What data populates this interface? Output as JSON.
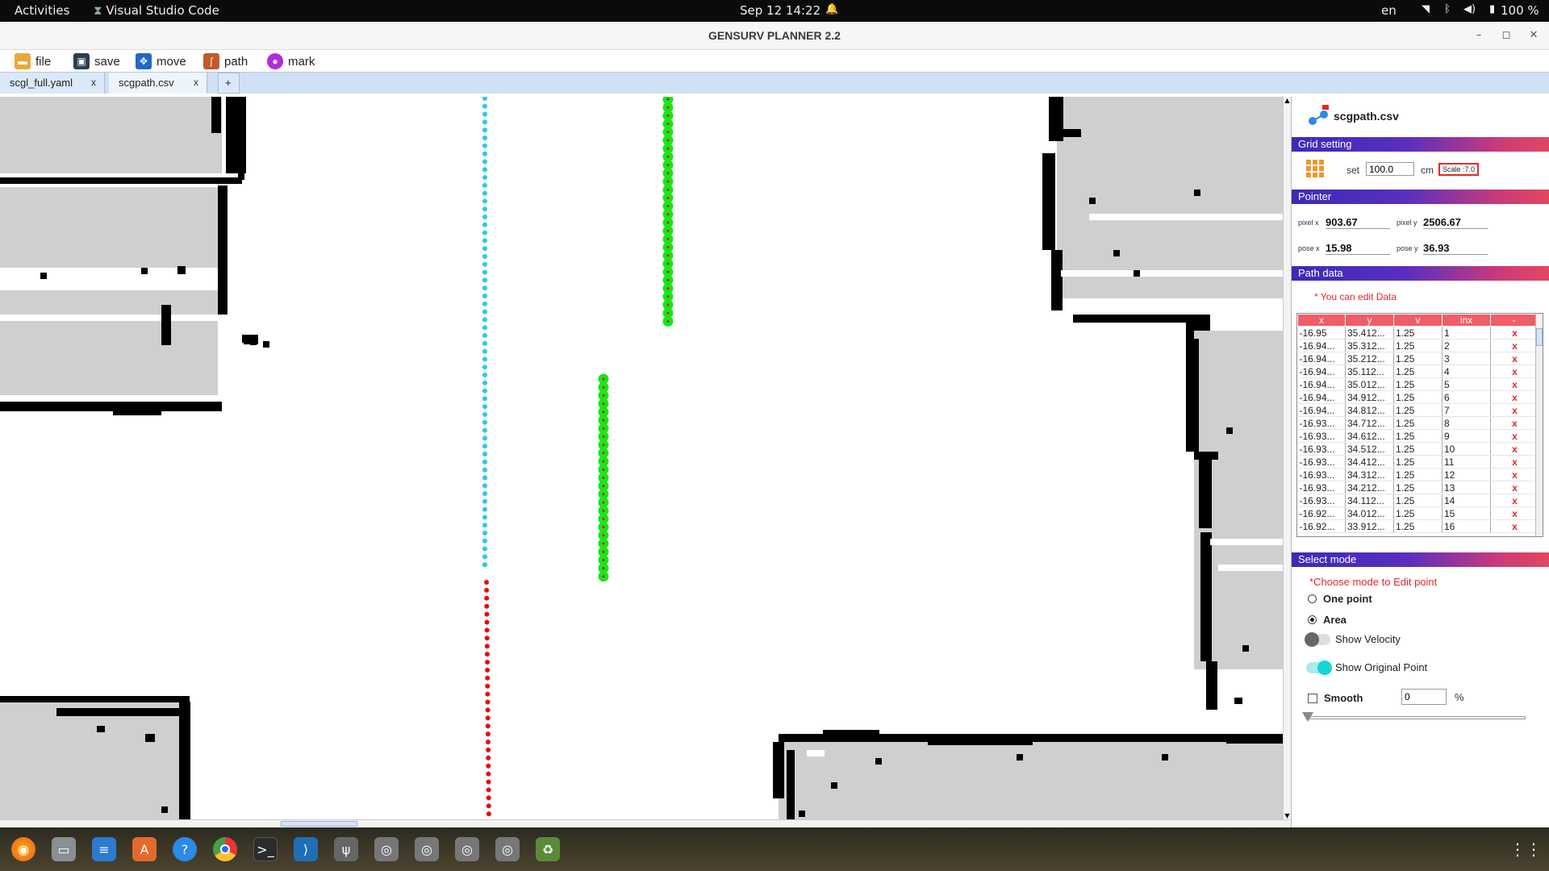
{
  "topbar": {
    "activities": "Activities",
    "app_name": "Visual Studio Code",
    "clock": "Sep 12  14:22",
    "lang": "en",
    "battery": "100 %"
  },
  "window": {
    "title": "GENSURV PLANNER 2.2"
  },
  "toolbar": {
    "file": "file",
    "save": "save",
    "move": "move",
    "path": "path",
    "mark": "mark"
  },
  "tabs": [
    {
      "label": "scgl_full.yaml",
      "close": "x"
    },
    {
      "label": "scgpath.csv",
      "close": "x"
    },
    {
      "label": "+"
    }
  ],
  "panel": {
    "file_name": "scgpath.csv",
    "grid": {
      "header": "Grid setting",
      "set_label": "set",
      "value": "100.0",
      "unit": "cm",
      "scale": "Scale :7.0"
    },
    "pointer": {
      "header": "Pointer",
      "pixel_x_label": "pixel x",
      "pixel_x": "903.67",
      "pixel_y_label": "pixel y",
      "pixel_y": "2506.67",
      "pose_x_label": "pose x",
      "pose_x": "15.98",
      "pose_y_label": "pose y",
      "pose_y": "36.93"
    },
    "path_data": {
      "header": "Path data",
      "note": "* You can edit Data",
      "columns": [
        "x",
        "y",
        "v",
        "inx",
        "-"
      ],
      "rows": [
        [
          "-16.95",
          "35.412...",
          "1.25",
          "1",
          "x"
        ],
        [
          "-16.94...",
          "35.312...",
          "1.25",
          "2",
          "x"
        ],
        [
          "-16.94...",
          "35.212...",
          "1.25",
          "3",
          "x"
        ],
        [
          "-16.94...",
          "35.112...",
          "1.25",
          "4",
          "x"
        ],
        [
          "-16.94...",
          "35.012...",
          "1.25",
          "5",
          "x"
        ],
        [
          "-16.94...",
          "34.912...",
          "1.25",
          "6",
          "x"
        ],
        [
          "-16.94...",
          "34.812...",
          "1.25",
          "7",
          "x"
        ],
        [
          "-16.93...",
          "34.712...",
          "1.25",
          "8",
          "x"
        ],
        [
          "-16.93...",
          "34.612...",
          "1.25",
          "9",
          "x"
        ],
        [
          "-16.93...",
          "34.512...",
          "1.25",
          "10",
          "x"
        ],
        [
          "-16.93...",
          "34.412...",
          "1.25",
          "11",
          "x"
        ],
        [
          "-16.93...",
          "34.312...",
          "1.25",
          "12",
          "x"
        ],
        [
          "-16.93...",
          "34.212...",
          "1.25",
          "13",
          "x"
        ],
        [
          "-16.93...",
          "34.112...",
          "1.25",
          "14",
          "x"
        ],
        [
          "-16.92...",
          "34.012...",
          "1.25",
          "15",
          "x"
        ],
        [
          "-16.92...",
          "33.912...",
          "1.25",
          "16",
          "x"
        ]
      ]
    },
    "select_mode": {
      "header": "Select mode",
      "note": "*Choose mode to Edit point",
      "one_point": "One point",
      "area": "Area",
      "selected": "Area",
      "show_velocity": "Show Velocity",
      "show_velocity_on": false,
      "show_original": "Show Original Point",
      "show_original_on": true,
      "smooth": "Smooth",
      "smooth_checked": false,
      "smooth_value": "0",
      "smooth_unit": "%"
    }
  },
  "colors": {
    "path_cyan": "#2ec8e6",
    "path_red": "#e01010",
    "point_green": "#19e619",
    "accent_gradient_start": "#3b2bb5",
    "accent_gradient_end": "#e3475f",
    "tab_bar": "#cfe0f5"
  },
  "dock_icons": [
    "firefox-icon",
    "files-icon",
    "writer-icon",
    "software-icon",
    "help-icon",
    "chrome-icon",
    "terminal-icon",
    "vscode-icon",
    "usb-icon",
    "disk-icon",
    "disk-icon",
    "disk-icon",
    "disk-icon",
    "trash-icon",
    "apps-grid-icon"
  ]
}
